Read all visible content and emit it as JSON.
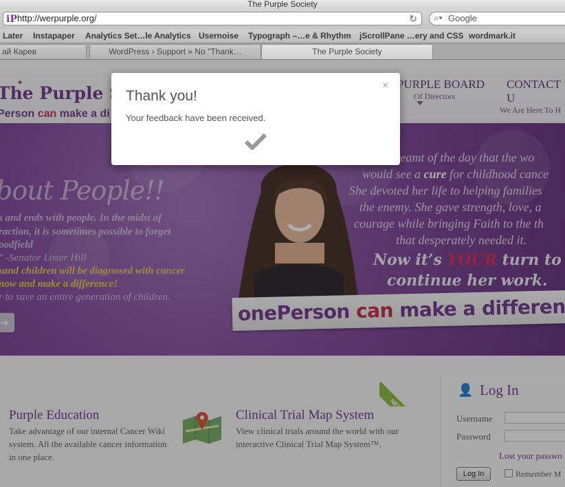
{
  "browser": {
    "window_title": "The Purple Society",
    "url": "http://werpurple.org/",
    "search_placeholder": "Google",
    "bookmarks": [
      "Later",
      "Instapaper",
      "Analytics Set…le Analytics",
      "Usernoise",
      "Typograph –…e & Rhythm",
      "jScrollPane …ery and CSS",
      "wordmark.it"
    ],
    "tabs": [
      {
        "label": "ай Карев",
        "active": false
      },
      {
        "label": "WordPress › Support » No \"Thank…",
        "active": false
      },
      {
        "label": "The Purple Society",
        "active": true
      }
    ]
  },
  "header": {
    "logo_line1": "The Purple Soc",
    "logo_line2_a": "Person ",
    "logo_line2_b": "can",
    "logo_line2_c": " make a di",
    "nav": [
      {
        "main": "PURPLE BOARD",
        "sub": "Of Directors"
      },
      {
        "main": "CONTACT U",
        "sub": "We Are Here To H"
      }
    ]
  },
  "hero": {
    "about": "bout People!!",
    "left_lines": [
      "s and ends with people. In the midst of",
      "raction, it is sometimes possible to forget",
      "oodfield",
      "\" -Senator Lister Hill",
      "sand children will be diagnosed with cancer",
      "now and make a difference!",
      "r to save an entire generation of children."
    ],
    "quote_lines": [
      "dreamt of the day that the wo",
      "would see a cure for childhood cance",
      "She devoted her life to helping families",
      "the enemy. She gave strength, love, a",
      "courage while bringing Faith to the th",
      "that desperately needed it."
    ],
    "quote_hl": "cure",
    "big_line1_a": "Now it’s ",
    "big_line1_b": "YOUR",
    "big_line1_c": " turn to",
    "big_line2": "continue her work.",
    "banner_a": "one",
    "banner_b": "Person ",
    "banner_c": "can",
    "banner_d": " make a differenc",
    "arrow_glyph": "➔"
  },
  "features": [
    {
      "title": "Purple Education",
      "desc": "Take advantage of our internal Cancer Wiki system. All the available cancer information in one place."
    },
    {
      "title": "Clinical Trial Map System",
      "desc": "View clinical trials around the world with our interactive Clinical Trial Map System™.",
      "ribbon": "NEW"
    }
  ],
  "login": {
    "title": "Log In",
    "username_label": "Username",
    "password_label": "Password",
    "lost_password": "Lost your passwo",
    "button": "Log In",
    "remember": "Remember M"
  },
  "modal": {
    "title": "Thank you!",
    "message": "Your feedback have been received.",
    "close": "×"
  },
  "colors": {
    "brand_purple": "#6b2f8a",
    "accent_red": "#c0233f",
    "ribbon_green": "#86b833"
  }
}
